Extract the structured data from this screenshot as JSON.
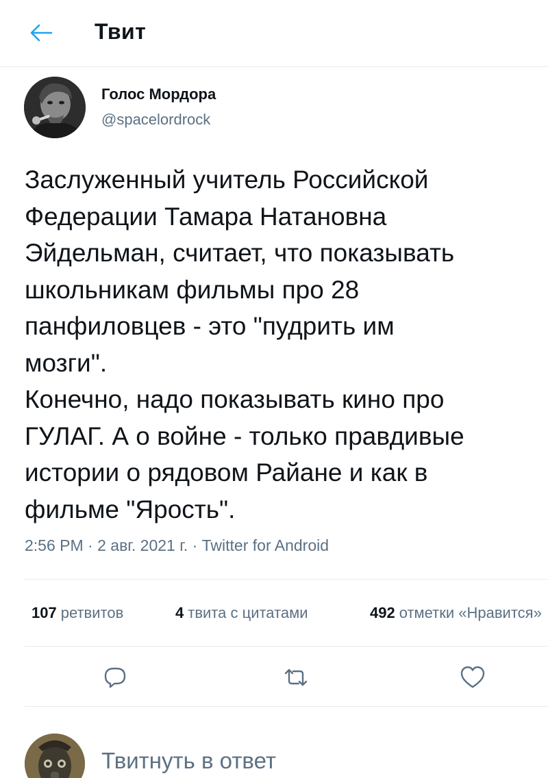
{
  "header": {
    "title": "Твит",
    "back_icon": "arrow-left-icon"
  },
  "author": {
    "name": "Голос Мордора",
    "handle": "@spacelordrock"
  },
  "tweet": {
    "lines": [
      "Заслуженный учитель Российской",
      "Федерации Тамара Натановна",
      "Эйдельман, считает, что показывать",
      "школьникам фильмы про 28",
      "панфиловцев - это \"пудрить им",
      "мозги\".",
      "Конечно, надо показывать кино про",
      "ГУЛАГ. А о войне - только правдивые",
      "истории о рядовом Райане и как в",
      "фильме \"Ярость\"."
    ]
  },
  "meta": {
    "time": "2:56 PM",
    "separator": "·",
    "date": "2 авг. 2021 г.",
    "source": "Twitter for Android"
  },
  "stats": {
    "retweets": {
      "count": "107",
      "label": "ретвитов"
    },
    "quotes": {
      "count": "4",
      "label": "твита с цитатами"
    },
    "likes": {
      "count": "492",
      "label": "отметки «Нравится»"
    }
  },
  "actions": {
    "reply_icon": "reply-icon",
    "retweet_icon": "retweet-icon",
    "like_icon": "heart-icon",
    "icon_color": "#5b7083"
  },
  "reply": {
    "placeholder": "Твитнуть в ответ"
  },
  "colors": {
    "accent": "#1da1f2",
    "secondary_text": "#5b7083",
    "divider": "#e6ecf0"
  }
}
